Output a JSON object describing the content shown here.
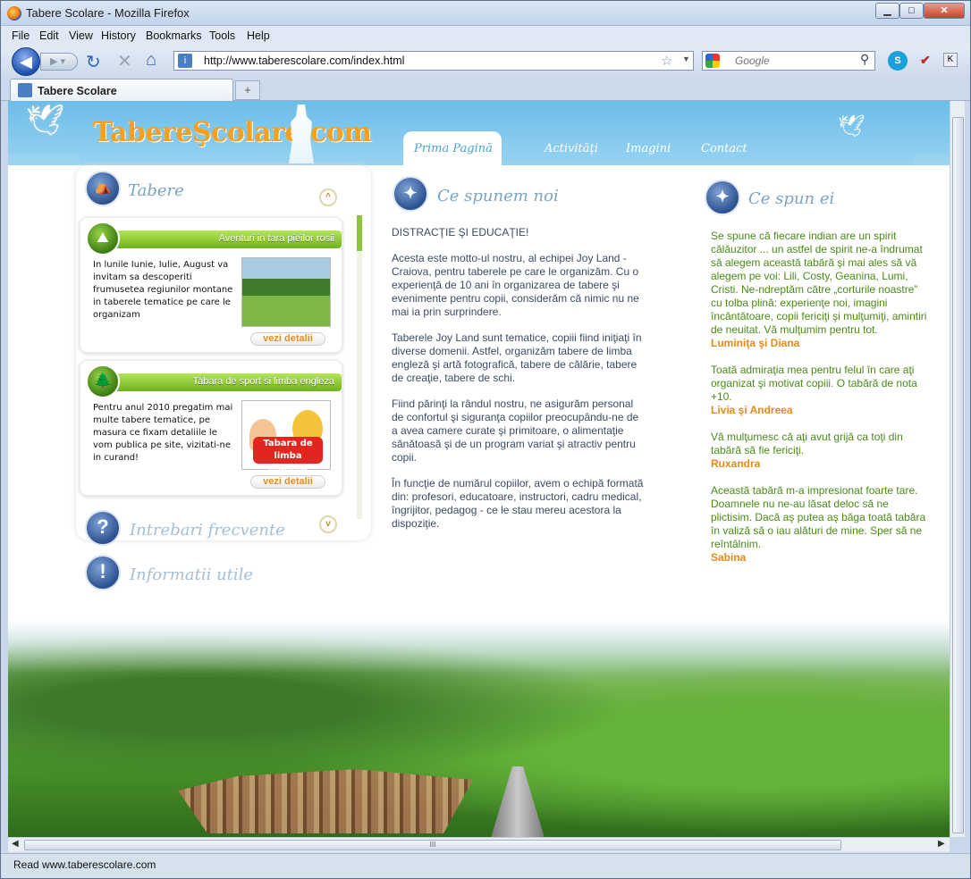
{
  "window": {
    "title": "Tabere Scolare - Mozilla Firefox",
    "min": "▁",
    "max": "□",
    "close": "✕"
  },
  "menu": [
    "File",
    "Edit",
    "View",
    "History",
    "Bookmarks",
    "Tools",
    "Help"
  ],
  "nav": {
    "url": "http://www.taberescolare.com/index.html",
    "search_placeholder": "Google",
    "skype": "S",
    "k": "K"
  },
  "tab": {
    "title": "Tabere Scolare",
    "new_tab": "+"
  },
  "site": {
    "logo": "TabereŞcolare.com",
    "nav_tabs": [
      "Prima Pagină",
      "Activităţi",
      "Imagini",
      "Contact"
    ],
    "left": {
      "title": "Tabere",
      "cards": [
        {
          "title": "Aventuri in tara pieilor rosii",
          "text": "In lunile Iunie, Iulie, August va invitam sa descoperiti frumusetea regiunilor montane in taberele tematice pe care le organizam",
          "button": "vezi detalii"
        },
        {
          "title": "Tabara de sport si limba engleza",
          "text": "Pentru anul 2010 pregatim mai multe tabere tematice, pe masura ce fixam detaliile le vom publica pe site, vizitati-ne in curand!",
          "button": "vezi detalii",
          "photo_caption": "Tabara de limba engleza"
        }
      ],
      "faq": "Intrebari frecvente",
      "info": "Informatii utile"
    },
    "middle": {
      "title": "Ce spunem noi",
      "heading": "DISTRACŢIE ŞI EDUCAŢIE!",
      "paragraphs": [
        "Acesta este motto-ul nostru, al echipei Joy Land - Craiova, pentru taberele pe care le organizăm. Cu o experienţă de 10 ani în organizarea de tabere şi evenimente pentru copii, considerăm că nimic nu ne mai ia prin surprindere.",
        "Taberele Joy Land sunt tematice, copiii fiind iniţiaţi în diverse domenii. Astfel, organizăm tabere de limba engleză şi artă fotografică, tabere de călărie, tabere de creaţie, tabere de schi.",
        "Fiind părinţi la rândul nostru, ne asigurăm personal de confortul şi siguranţa copiilor preocupându-ne de a avea camere curate şi primitoare, o alimentaţie sănătoasă şi de un program variat şi atractiv pentru copii.",
        "În funcţie de numărul copiilor, avem o echipă formată din: profesori, educatoare, instructori, cadru medical, îngrijitor, pedagog - ce le stau mereu acestora la dispoziţie."
      ]
    },
    "right": {
      "title": "Ce spun ei",
      "testimonials": [
        {
          "text": "Se spune că fiecare indian are un spirit călăuzitor ... un astfel de spirit ne-a îndrumat să alegem această tabără şi mai ales să vă alegem pe voi: Lili, Costy, Geanina, Lumi, Cristi. Ne-ndreptăm către „corturile noastre” cu tolba plină: experienţe noi, imagini încântătoare, copii fericiţi şi mulţumiţi, amintiri de neuitat. Vă mulţumim pentru tot.",
          "author": "Luminiţa şi Diana"
        },
        {
          "text": "Toată admiraţia mea pentru felul în care aţi organizat şi motivat copiii. O tabără de nota +10.",
          "author": "Livia şi Andreea"
        },
        {
          "text": "Vă mulţumesc că aţi avut grijă ca toţi din tabără să fie fericiţi.",
          "author": "Ruxandra"
        },
        {
          "text": "Această tabără m-a impresionat foarte tare. Doamnele nu ne-au lăsat deloc să ne plictisim. Dacă aş putea aş băga toată tabăra în valiză să o iau alături de mine. Sper să ne reîntâlnim.",
          "author": "Sabina"
        }
      ]
    }
  },
  "status": "Read www.taberescolare.com"
}
